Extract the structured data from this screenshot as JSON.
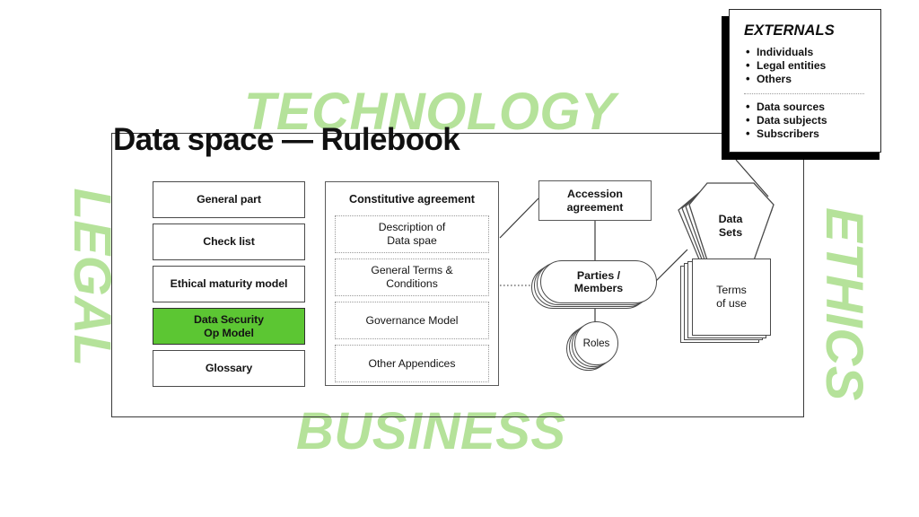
{
  "page_title": "Data space — Rulebook",
  "watermarks": {
    "top": "TECHNOLOGY",
    "bottom": "BUSINESS",
    "left": "LEGAL",
    "right": "ETHICS",
    "color": "#b5e29a"
  },
  "left_column": {
    "items": [
      {
        "label": "General part",
        "highlighted": false
      },
      {
        "label": "Check list",
        "highlighted": false
      },
      {
        "label": "Ethical maturity model",
        "highlighted": false
      },
      {
        "label": "Data Security\nOp Model",
        "highlighted": true
      },
      {
        "label": "Glossary",
        "highlighted": false
      }
    ],
    "highlight_color": "#5cc633"
  },
  "constitutive_agreement": {
    "title": "Constitutive agreement",
    "items": [
      "Description of\nData spae",
      "General Terms &\nConditions",
      "Governance Model",
      "Other Appendices"
    ]
  },
  "accession_agreement": {
    "label": "Accession\nagreement"
  },
  "parties_members": {
    "label": "Parties /\nMembers"
  },
  "roles": {
    "label": "Roles"
  },
  "data_sets": {
    "label": "Data\nSets"
  },
  "terms_of_use": {
    "label": "Terms\nof use"
  },
  "externals": {
    "title": "EXTERNALS",
    "group_one": [
      "Individuals",
      "Legal entities",
      "Others"
    ],
    "group_two": [
      "Data sources",
      "Data subjects",
      "Subscribers"
    ]
  }
}
